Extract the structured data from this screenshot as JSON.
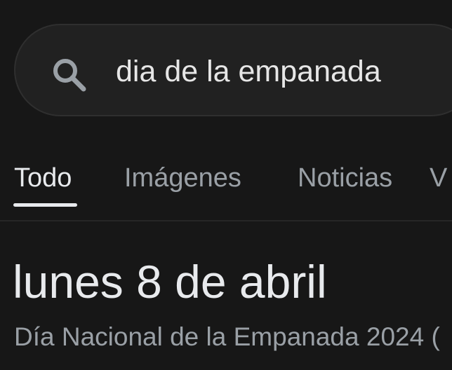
{
  "search": {
    "query": "dia de la empanada",
    "icon": "search-icon"
  },
  "tabs": [
    {
      "label": "Todo",
      "active": true
    },
    {
      "label": "Imágenes",
      "active": false
    },
    {
      "label": "Noticias",
      "active": false
    },
    {
      "label": "V",
      "active": false
    }
  ],
  "answer": {
    "title": "lunes 8 de abril",
    "subtitle": "Día Nacional de la Empanada 2024 ("
  },
  "colors": {
    "background": "#171717",
    "search_bg": "#212121",
    "text_primary": "#e8eaed",
    "text_secondary": "#9aa0a6"
  }
}
